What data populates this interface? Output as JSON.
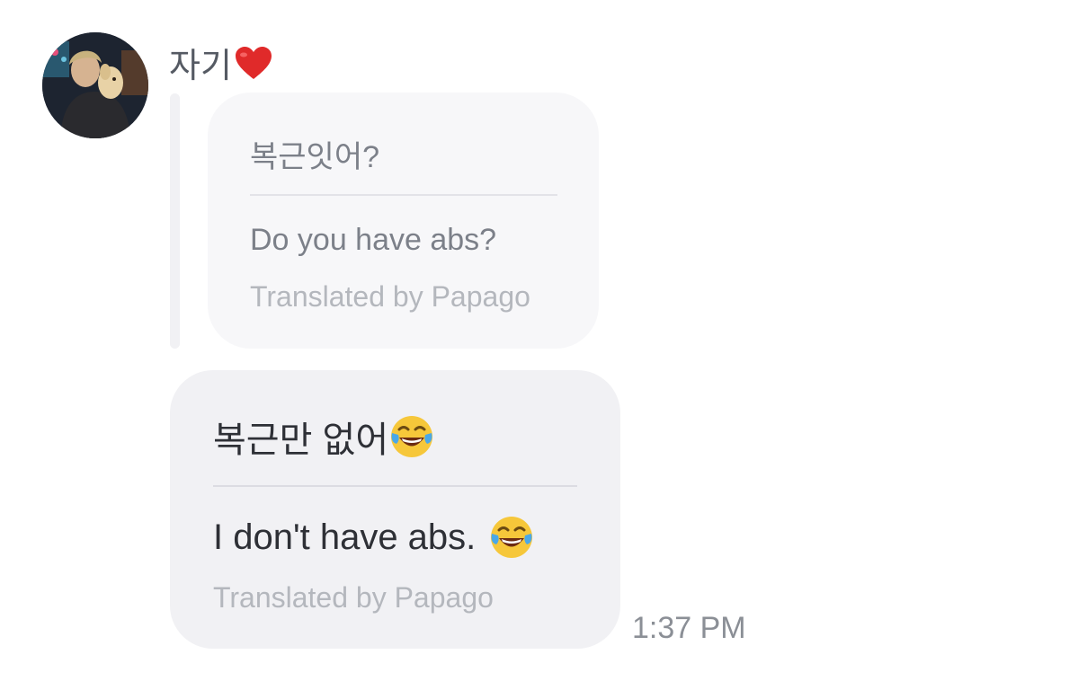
{
  "conversation": {
    "sender_name": "자기",
    "sender_name_emoji": "red-heart-icon"
  },
  "quoted_message": {
    "original": "복근잇어?",
    "translation": "Do you have abs?",
    "credit": "Translated by Papago"
  },
  "reply_message": {
    "original": "복근만 없어",
    "original_emoji": "face-with-tears-of-joy-icon",
    "translation": "I don't have abs.",
    "translation_emoji": "face-with-tears-of-joy-icon",
    "credit": "Translated by Papago",
    "timestamp": "1:37 PM"
  },
  "colors": {
    "quoted_bubble_bg": "#f7f7f9",
    "reply_bubble_bg": "#f1f1f4",
    "heart": "#e02a2a",
    "emoji_face": "#f6c73a"
  }
}
